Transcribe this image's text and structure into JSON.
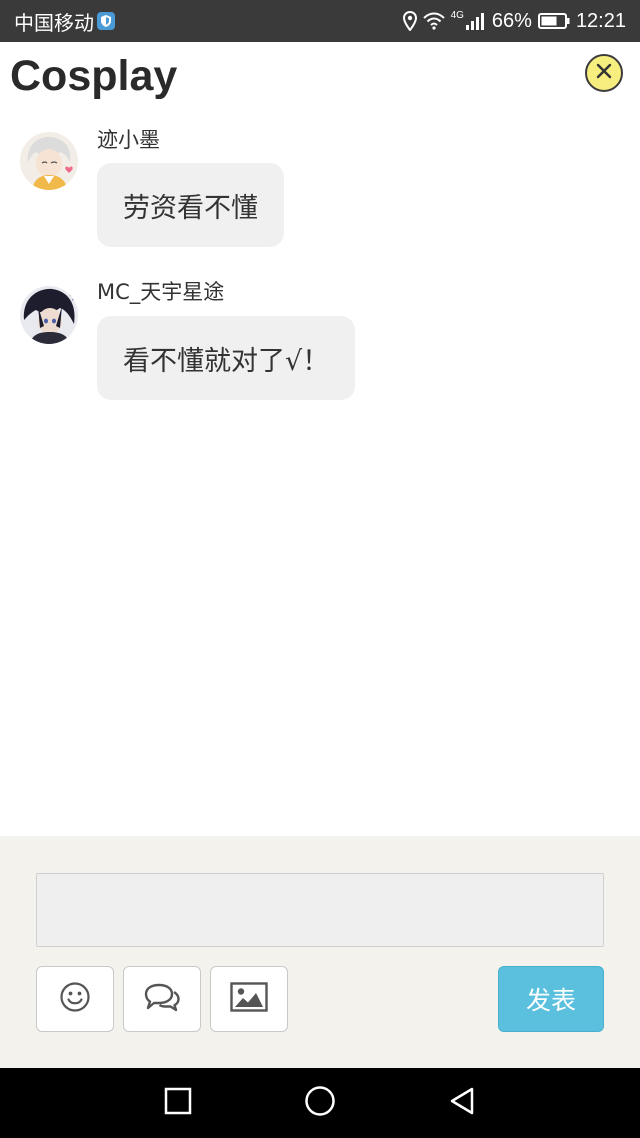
{
  "status_bar": {
    "carrier": "中国移动",
    "network_type": "4G",
    "battery": "66%",
    "time": "12:21"
  },
  "header": {
    "title": "Cosplay",
    "close_icon": "close-circle-icon"
  },
  "messages": [
    {
      "sender": "迹小墨",
      "text": "劳资看不懂",
      "avatar": "avatar-white-hair-character"
    },
    {
      "sender": "MC_天宇星途",
      "text": "看不懂就对了√！",
      "avatar": "avatar-dark-hair-character"
    }
  ],
  "composer": {
    "input_value": "",
    "placeholder": "",
    "tools": [
      "emoji-icon",
      "chat-bubbles-icon",
      "image-icon"
    ],
    "send_label": "发表",
    "send_color": "#5bc0de"
  },
  "nav_bar": {
    "buttons": [
      "recent-apps-icon",
      "home-icon",
      "back-icon"
    ]
  }
}
